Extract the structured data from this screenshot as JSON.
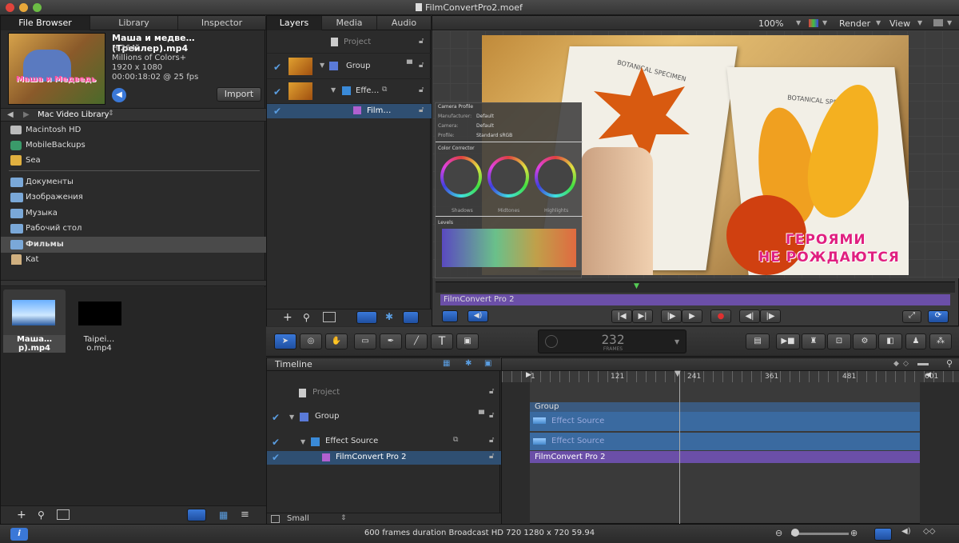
{
  "window": {
    "title": "FilmConvertPro2.moef"
  },
  "left_tabs": [
    "File Browser",
    "Library",
    "Inspector"
  ],
  "file_preview": {
    "name": "Маша и медве…(Трейлер).mp4",
    "codec": "H.264",
    "colors": "Millions of Colors+",
    "resolution": "1920 x 1080",
    "duration": "00:00:18:02 @ 25 fps",
    "import_label": "Import",
    "thumb_text": "Маша и Медведь"
  },
  "location": {
    "label": "Mac Video Library"
  },
  "sidebar": {
    "devices": [
      {
        "icon": "hard-drive-icon",
        "label": "Macintosh HD"
      },
      {
        "icon": "time-machine-icon",
        "label": "MobileBackups"
      },
      {
        "icon": "drive-icon",
        "label": "Sea"
      }
    ],
    "folders": [
      {
        "label": "Документы"
      },
      {
        "label": "Изображения"
      },
      {
        "label": "Музыка"
      },
      {
        "label": "Рабочий стол"
      },
      {
        "label": "Фильмы",
        "selected": true
      },
      {
        "label": "Kat",
        "home": true
      }
    ]
  },
  "files": [
    {
      "label": "Маша…р).mp4",
      "selected": true
    },
    {
      "label": "Taipei…o.mp4"
    }
  ],
  "middle_tabs": [
    "Layers",
    "Media",
    "Audio"
  ],
  "layers": {
    "project": "Project",
    "group": "Group",
    "effect": "Effe…",
    "film": "Film…"
  },
  "viewer": {
    "zoom": "100%",
    "render": "Render",
    "view": "View",
    "title_line1": "ГЕРОЯМИ",
    "title_line2": "НЕ РОЖДАЮТСЯ",
    "book_text1": "BOTANICAL SPECIMEN",
    "book_text2": "BOTANICAL SPECIMEN",
    "overlay": {
      "camera_profile": "Camera Profile",
      "manufacturer_label": "Manufacturer:",
      "manufacturer": "Default",
      "camera_label": "Camera:",
      "camera": "Default",
      "profile_label": "Profile:",
      "profile": "Standard sRGB",
      "color_corrector": "Color Corrector",
      "wheels": [
        "Shadows",
        "Midtones",
        "Highlights"
      ],
      "levels": "Levels"
    },
    "mini_timeline_bar": "FilmConvert Pro 2"
  },
  "toolbar": {
    "frame_count": "232",
    "frame_unit": "FRAMES"
  },
  "timeline": {
    "title": "Timeline",
    "rows": [
      "Project",
      "Group",
      "Effect Source",
      "FilmConvert Pro 2"
    ],
    "size_label": "Small",
    "ruler_ticks": [
      "1",
      "121",
      "241",
      "361",
      "481",
      "601"
    ],
    "bars": {
      "group": "Group",
      "effect1": "Effect Source",
      "effect2": "Effect Source",
      "film": "FilmConvert Pro 2"
    }
  },
  "status": {
    "text": "600 frames duration Broadcast HD 720 1280 x 720 59.94"
  },
  "colors": {
    "accent": "#3a78d8",
    "purple_bar": "#6b4fa8",
    "blue_bar": "#2f5a8a"
  }
}
